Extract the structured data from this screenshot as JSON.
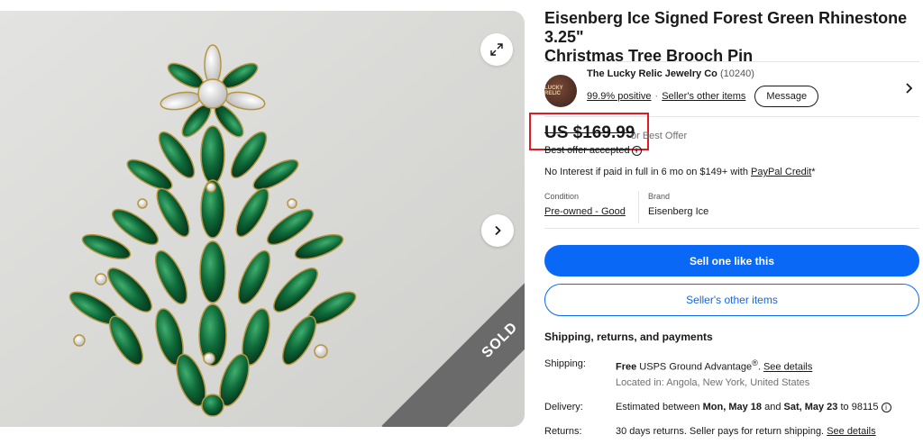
{
  "gallery": {
    "sold_label": "SOLD",
    "icons": {
      "expand": "expand-icon",
      "next": "chevron-right-icon"
    }
  },
  "listing": {
    "title_line1": "Eisenberg Ice Signed Forest Green Rhinestone 3.25\"",
    "title_line2": "Christmas Tree Brooch Pin"
  },
  "seller": {
    "avatar_text": "LUCKY RELIC",
    "name": "The Lucky Relic Jewelry Co",
    "feedback_count": "(10240)",
    "positive": "99.9% positive",
    "other_items": "Seller's other items",
    "message_button": "Message"
  },
  "pricing": {
    "price": "US $169.99",
    "best_offer": "or Best Offer",
    "offer_accepted": "Best offer accepted",
    "financing_prefix": "No Interest if paid in full in 6 mo on $149+ with ",
    "financing_link": "PayPal Credit",
    "financing_suffix": "*",
    "highlight_color": "#e01b24"
  },
  "specs": {
    "condition_label": "Condition",
    "condition_value": "Pre-owned - Good",
    "brand_label": "Brand",
    "brand_value": "Eisenberg Ice"
  },
  "actions": {
    "sell_one": "Sell one like this",
    "sellers_other_items": "Seller's other items",
    "primary_color": "#0968f6"
  },
  "shipping": {
    "heading": "Shipping, returns, and payments",
    "shipping_label": "Shipping:",
    "shipping_free": "Free",
    "shipping_service": " USPS Ground Advantage",
    "shipping_reg": "®",
    "shipping_period": ". ",
    "see_details": "See details",
    "located_in": "Located in: Angola, New York, United States",
    "delivery_label": "Delivery:",
    "delivery_prefix": "Estimated between ",
    "delivery_start": "Mon, May 18",
    "delivery_and": " and ",
    "delivery_end": "Sat, May 23",
    "delivery_to": " to 98115 ",
    "returns_label": "Returns:",
    "returns_text": "30 days returns. Seller pays for return shipping. ",
    "returns_link": "See details"
  }
}
